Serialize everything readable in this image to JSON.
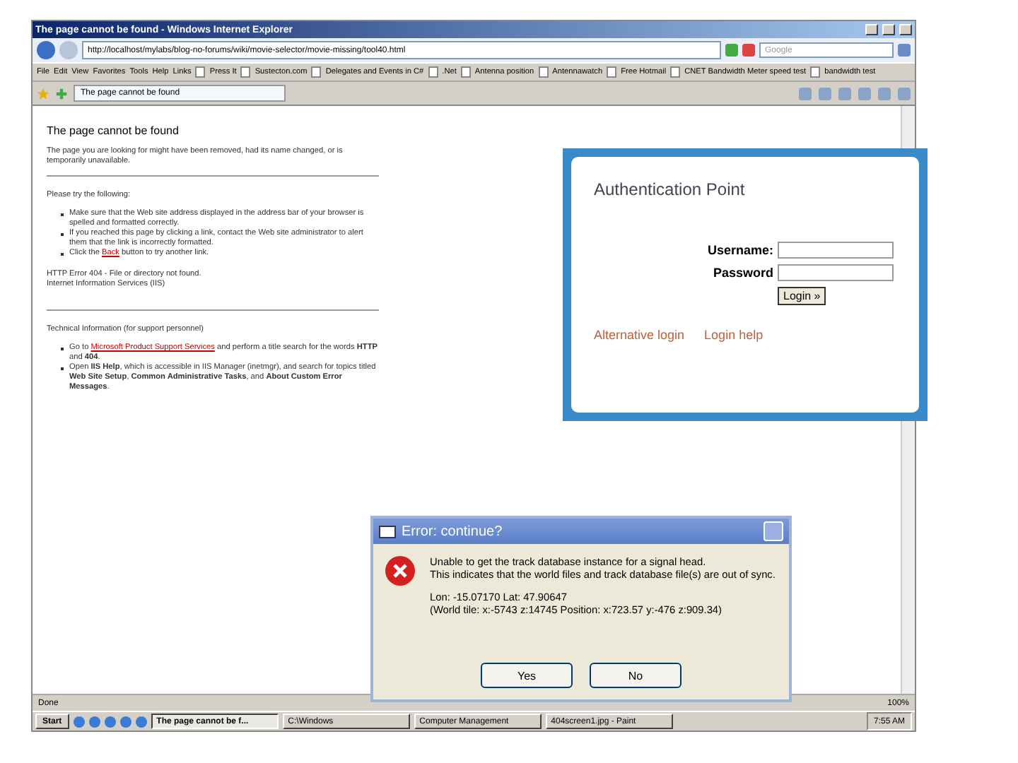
{
  "window": {
    "title": "The page cannot be found - Windows Internet Explorer"
  },
  "address_bar": {
    "url": "http://localhost/mylabs/blog-no-forums/wiki/movie-selector/movie-missing/tool40.html"
  },
  "search": {
    "placeholder": "Google"
  },
  "menu": [
    "File",
    "Edit",
    "View",
    "Favorites",
    "Tools",
    "Help"
  ],
  "links": [
    "Links",
    "Press It",
    "Sustecton.com",
    "Delegates and Events in C#",
    ".Net",
    "Antenna position",
    "Antennawatch",
    "Free Hotmail",
    "CNET Bandwidth Meter speed test",
    "bandwidth test"
  ],
  "tab": {
    "label": "The page cannot be found"
  },
  "page": {
    "heading": "The page cannot be found",
    "intro": "The page you are looking for might have been removed, had its name changed, or is temporarily unavailable.",
    "try_heading": "Please try the following:",
    "suggestions": [
      {
        "before": "Make sure that the Web site address displayed in the address bar of your browser is spelled and formatted correctly."
      },
      {
        "before": "If you reached this page by clicking a link, contact the Web site administrator to alert them that the link is incorrectly formatted."
      },
      {
        "before": "Click the ",
        "link": "Back",
        "after": " button to try another link."
      }
    ],
    "error_lines": [
      "HTTP Error 404 - File or directory not found.",
      "Internet Information Services (IIS)"
    ],
    "tech_heading": "Technical Information (for support personnel)",
    "tech_items": [
      {
        "before": "Go to ",
        "link": "Microsoft Product Support Services",
        "after": " and perform a title search for the words **HTTP** and **404**."
      },
      {
        "before": "Open **IIS Help**, which is accessible in IIS Manager (inetmgr), and search for topics titled **Web Site Setup**, **Common Administrative Tasks**, and **About Custom Error Messages**."
      }
    ]
  },
  "status_bar": {
    "text": "Done",
    "zoom": "100%"
  },
  "taskbar": {
    "start": "Start",
    "tasks": [
      {
        "label": "The page cannot be f...",
        "selected": true
      },
      {
        "label": "C:\\Windows",
        "selected": false
      },
      {
        "label": "Computer Management",
        "selected": false
      },
      {
        "label": "404screen1.jpg - Paint",
        "selected": false
      }
    ],
    "clock": "7:55 AM"
  },
  "auth_panel": {
    "title": "Authentication Point",
    "username_label": "Username:",
    "password_label": "Password",
    "login_button": "Login »",
    "links": [
      "Alternative login",
      "Login help"
    ]
  },
  "dialog": {
    "title": "Error: continue?",
    "message": [
      "Unable to get the track database instance for a signal head.",
      "This indicates that the world files and track database file(s) are out of sync."
    ],
    "details": [
      "Lon: -15.07170 Lat: 47.90647",
      "(World tile: x:-5743 z:14745 Position: x:723.57 y:-476 z:909.34)"
    ],
    "buttons": [
      "Yes",
      "No"
    ]
  }
}
